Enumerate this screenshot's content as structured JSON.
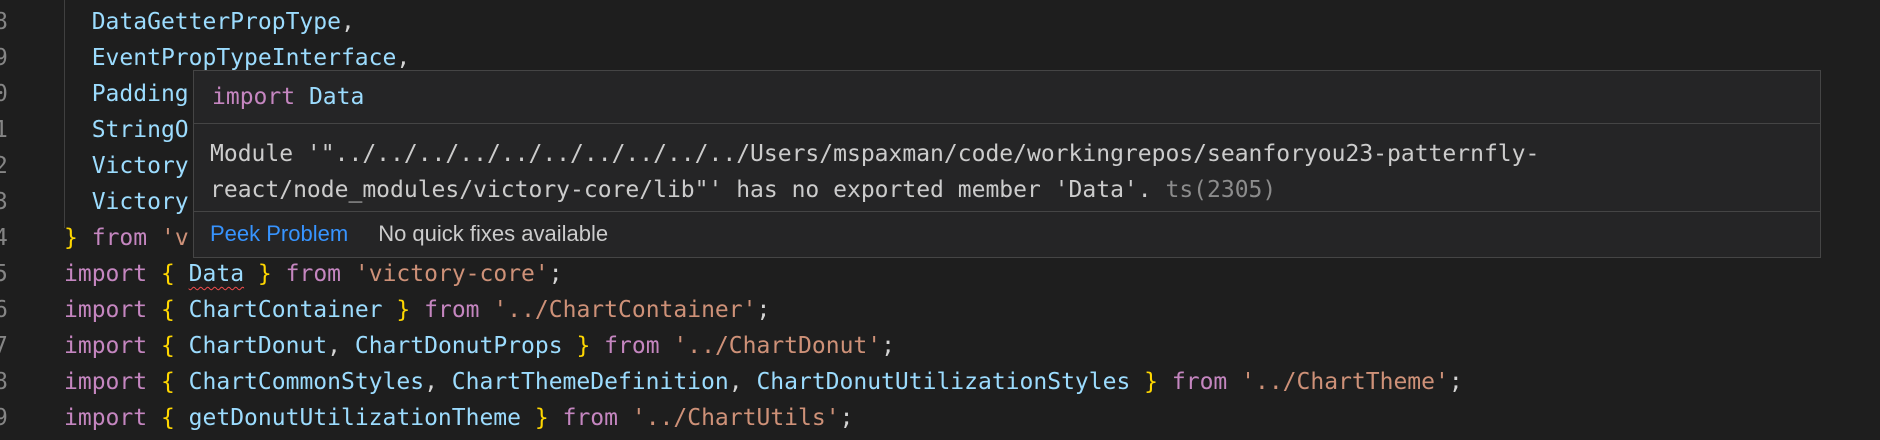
{
  "editor": {
    "lines": [
      {
        "number": "8",
        "indent": "  ",
        "tokens": [
          {
            "cls": "id",
            "text": "DataGetterPropType"
          },
          {
            "cls": "pn",
            "text": ","
          }
        ]
      },
      {
        "number": "9",
        "indent": "  ",
        "tokens": [
          {
            "cls": "id",
            "text": "EventPropTypeInterface"
          },
          {
            "cls": "pn",
            "text": ","
          }
        ]
      },
      {
        "number": "0",
        "indent": "  ",
        "tokens": [
          {
            "cls": "id",
            "text": "Padding"
          }
        ]
      },
      {
        "number": "1",
        "indent": "  ",
        "tokens": [
          {
            "cls": "id",
            "text": "StringO"
          }
        ]
      },
      {
        "number": "2",
        "indent": "  ",
        "tokens": [
          {
            "cls": "id",
            "text": "Victory"
          }
        ]
      },
      {
        "number": "3",
        "indent": "  ",
        "tokens": [
          {
            "cls": "id",
            "text": "Victory"
          }
        ]
      },
      {
        "number": "4",
        "indent": "",
        "tokens": [
          {
            "cls": "br",
            "text": "}"
          },
          {
            "cls": "pn",
            "text": " "
          },
          {
            "cls": "kw",
            "text": "from"
          },
          {
            "cls": "pn",
            "text": " "
          },
          {
            "cls": "str",
            "text": "'v"
          }
        ]
      },
      {
        "number": "5",
        "indent": "",
        "tokens": [
          {
            "cls": "kw",
            "text": "import"
          },
          {
            "cls": "pn",
            "text": " "
          },
          {
            "cls": "br",
            "text": "{"
          },
          {
            "cls": "pn",
            "text": " "
          },
          {
            "cls": "id squiggle",
            "text": "Data"
          },
          {
            "cls": "pn",
            "text": " "
          },
          {
            "cls": "br",
            "text": "}"
          },
          {
            "cls": "pn",
            "text": " "
          },
          {
            "cls": "kw",
            "text": "from"
          },
          {
            "cls": "pn",
            "text": " "
          },
          {
            "cls": "str",
            "text": "'victory-core'"
          },
          {
            "cls": "pn",
            "text": ";"
          }
        ]
      },
      {
        "number": "6",
        "indent": "",
        "tokens": [
          {
            "cls": "kw",
            "text": "import"
          },
          {
            "cls": "pn",
            "text": " "
          },
          {
            "cls": "br",
            "text": "{"
          },
          {
            "cls": "pn",
            "text": " "
          },
          {
            "cls": "id",
            "text": "ChartContainer"
          },
          {
            "cls": "pn",
            "text": " "
          },
          {
            "cls": "br",
            "text": "}"
          },
          {
            "cls": "pn",
            "text": " "
          },
          {
            "cls": "kw",
            "text": "from"
          },
          {
            "cls": "pn",
            "text": " "
          },
          {
            "cls": "str",
            "text": "'../ChartContainer'"
          },
          {
            "cls": "pn",
            "text": ";"
          }
        ]
      },
      {
        "number": "7",
        "indent": "",
        "tokens": [
          {
            "cls": "kw",
            "text": "import"
          },
          {
            "cls": "pn",
            "text": " "
          },
          {
            "cls": "br",
            "text": "{"
          },
          {
            "cls": "pn",
            "text": " "
          },
          {
            "cls": "id",
            "text": "ChartDonut"
          },
          {
            "cls": "pn",
            "text": ", "
          },
          {
            "cls": "id",
            "text": "ChartDonutProps"
          },
          {
            "cls": "pn",
            "text": " "
          },
          {
            "cls": "br",
            "text": "}"
          },
          {
            "cls": "pn",
            "text": " "
          },
          {
            "cls": "kw",
            "text": "from"
          },
          {
            "cls": "pn",
            "text": " "
          },
          {
            "cls": "str",
            "text": "'../ChartDonut'"
          },
          {
            "cls": "pn",
            "text": ";"
          }
        ]
      },
      {
        "number": "8",
        "indent": "",
        "tokens": [
          {
            "cls": "kw",
            "text": "import"
          },
          {
            "cls": "pn",
            "text": " "
          },
          {
            "cls": "br",
            "text": "{"
          },
          {
            "cls": "pn",
            "text": " "
          },
          {
            "cls": "id",
            "text": "ChartCommonStyles"
          },
          {
            "cls": "pn",
            "text": ", "
          },
          {
            "cls": "id",
            "text": "ChartThemeDefinition"
          },
          {
            "cls": "pn",
            "text": ", "
          },
          {
            "cls": "id",
            "text": "ChartDonutUtilizationStyles"
          },
          {
            "cls": "pn",
            "text": " "
          },
          {
            "cls": "br",
            "text": "}"
          },
          {
            "cls": "pn",
            "text": " "
          },
          {
            "cls": "kw",
            "text": "from"
          },
          {
            "cls": "pn",
            "text": " "
          },
          {
            "cls": "str",
            "text": "'../ChartTheme'"
          },
          {
            "cls": "pn",
            "text": ";"
          }
        ]
      },
      {
        "number": "9",
        "indent": "",
        "tokens": [
          {
            "cls": "kw",
            "text": "import"
          },
          {
            "cls": "pn",
            "text": " "
          },
          {
            "cls": "br",
            "text": "{"
          },
          {
            "cls": "pn",
            "text": " "
          },
          {
            "cls": "id",
            "text": "getDonutUtilizationTheme"
          },
          {
            "cls": "pn",
            "text": " "
          },
          {
            "cls": "br",
            "text": "}"
          },
          {
            "cls": "pn",
            "text": " "
          },
          {
            "cls": "kw",
            "text": "from"
          },
          {
            "cls": "pn",
            "text": " "
          },
          {
            "cls": "str",
            "text": "'../ChartUtils'"
          },
          {
            "cls": "pn",
            "text": ";"
          }
        ]
      }
    ]
  },
  "hover": {
    "signature_keyword": "import",
    "signature_name": "Data",
    "message": "Module '\"../../../../../../../../../../Users/mspaxman/code/workingrepos/seanforyou23-patternfly-\nreact/node_modules/victory-core/lib\"' has no exported member 'Data'.",
    "error_code": "ts(2305)",
    "peek_label": "Peek Problem",
    "no_fixes_label": "No quick fixes available"
  },
  "colors": {
    "background": "#1e1e1e",
    "keyword": "#c586c0",
    "identifier": "#9cdcfe",
    "bracket": "#ffd700",
    "string": "#ce9178",
    "link": "#3794ff",
    "error": "#f14c4c"
  }
}
